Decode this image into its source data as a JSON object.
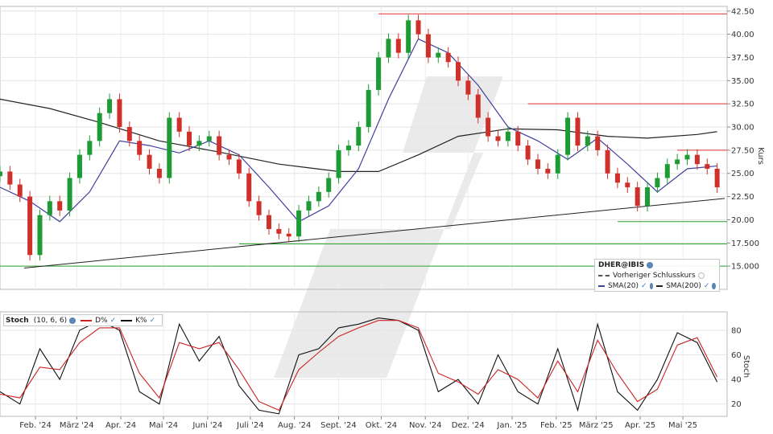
{
  "chart_data": [
    {
      "type": "candlestick",
      "title": "DHER@IBIS",
      "ylabel": "Kurs",
      "ylim": [
        12.5,
        43.0
      ],
      "y_ticks": [
        "15.000",
        "17.500",
        "20.00",
        "22.50",
        "25.00",
        "27.50",
        "30.00",
        "32.50",
        "35.00",
        "37.50",
        "40.00",
        "42.50"
      ],
      "x_ticks": [
        "Feb. '24",
        "März '24",
        "Apr. '24",
        "Mai '24",
        "Juni '24",
        "Juli '24",
        "Aug. '24",
        "Sept. '24",
        "Okt. '24",
        "Nov. '24",
        "Dez. '24",
        "Jan. '25",
        "Feb. '25",
        "März '25",
        "Apr. '25",
        "Mai '25"
      ],
      "grid": true,
      "legend_position": "bottom-right",
      "colors": {
        "up": "#1e9b35",
        "down": "#d0302a",
        "sma20": "#3f3f9e",
        "sma200": "#222222",
        "resistance": "#e03030",
        "support": "#2ca02c",
        "trend": "#222222"
      },
      "legend": {
        "title": "DHER@IBIS",
        "previous_close": "Vorheriger Schlusskurs",
        "sma20": "SMA(20)",
        "sma200": "SMA(200)"
      },
      "close_series": {
        "name": "DHER@IBIS",
        "points": [
          [
            "2024-01-15",
            25.2
          ],
          [
            "2024-01-22",
            23.8
          ],
          [
            "2024-01-29",
            22.5
          ],
          [
            "2024-02-05",
            16.2
          ],
          [
            "2024-02-12",
            20.5
          ],
          [
            "2024-02-19",
            22.0
          ],
          [
            "2024-02-26",
            21.0
          ],
          [
            "2024-03-04",
            24.5
          ],
          [
            "2024-03-11",
            27.0
          ],
          [
            "2024-03-18",
            28.5
          ],
          [
            "2024-03-25",
            31.5
          ],
          [
            "2024-04-01",
            33.0
          ],
          [
            "2024-04-08",
            30.0
          ],
          [
            "2024-04-15",
            28.5
          ],
          [
            "2024-04-22",
            27.0
          ],
          [
            "2024-04-29",
            25.5
          ],
          [
            "2024-05-06",
            24.5
          ],
          [
            "2024-05-13",
            31.0
          ],
          [
            "2024-05-20",
            29.5
          ],
          [
            "2024-05-27",
            28.0
          ],
          [
            "2024-06-03",
            28.5
          ],
          [
            "2024-06-10",
            29.0
          ],
          [
            "2024-06-17",
            27.0
          ],
          [
            "2024-06-24",
            26.5
          ],
          [
            "2024-07-01",
            25.0
          ],
          [
            "2024-07-08",
            22.0
          ],
          [
            "2024-07-15",
            20.5
          ],
          [
            "2024-07-22",
            19.0
          ],
          [
            "2024-07-29",
            18.5
          ],
          [
            "2024-08-05",
            18.2
          ],
          [
            "2024-08-12",
            21.0
          ],
          [
            "2024-08-19",
            22.0
          ],
          [
            "2024-08-26",
            23.0
          ],
          [
            "2024-09-02",
            24.5
          ],
          [
            "2024-09-09",
            27.5
          ],
          [
            "2024-09-16",
            28.0
          ],
          [
            "2024-09-23",
            30.0
          ],
          [
            "2024-09-30",
            34.0
          ],
          [
            "2024-10-07",
            37.5
          ],
          [
            "2024-10-14",
            39.5
          ],
          [
            "2024-10-21",
            38.0
          ],
          [
            "2024-10-28",
            41.5
          ],
          [
            "2024-11-04",
            40.0
          ],
          [
            "2024-11-11",
            37.5
          ],
          [
            "2024-11-18",
            38.0
          ],
          [
            "2024-11-25",
            37.0
          ],
          [
            "2024-12-02",
            35.0
          ],
          [
            "2024-12-09",
            33.5
          ],
          [
            "2024-12-16",
            31.0
          ],
          [
            "2024-12-23",
            29.0
          ],
          [
            "2024-12-30",
            28.5
          ],
          [
            "2025-01-06",
            29.5
          ],
          [
            "2025-01-13",
            28.0
          ],
          [
            "2025-01-20",
            26.5
          ],
          [
            "2025-01-27",
            25.5
          ],
          [
            "2025-02-03",
            25.0
          ],
          [
            "2025-02-10",
            27.0
          ],
          [
            "2025-02-17",
            31.0
          ],
          [
            "2025-02-24",
            28.0
          ],
          [
            "2025-03-03",
            29.0
          ],
          [
            "2025-03-10",
            27.5
          ],
          [
            "2025-03-17",
            25.0
          ],
          [
            "2025-03-24",
            24.0
          ],
          [
            "2025-03-31",
            23.5
          ],
          [
            "2025-04-07",
            21.5
          ],
          [
            "2025-04-14",
            23.5
          ],
          [
            "2025-04-21",
            24.5
          ],
          [
            "2025-04-28",
            26.0
          ],
          [
            "2025-05-05",
            26.5
          ],
          [
            "2025-05-12",
            27.0
          ],
          [
            "2025-05-19",
            26.0
          ],
          [
            "2025-05-26",
            25.5
          ],
          [
            "2025-06-02",
            23.5
          ]
        ]
      },
      "sma20_series": {
        "name": "SMA(20)",
        "points": [
          [
            "2024-01-15",
            23.5
          ],
          [
            "2024-02-05",
            22.0
          ],
          [
            "2024-02-26",
            19.8
          ],
          [
            "2024-03-18",
            23.0
          ],
          [
            "2024-04-08",
            28.5
          ],
          [
            "2024-04-29",
            28.0
          ],
          [
            "2024-05-20",
            27.2
          ],
          [
            "2024-06-10",
            28.5
          ],
          [
            "2024-07-01",
            27.0
          ],
          [
            "2024-07-22",
            23.5
          ],
          [
            "2024-08-12",
            19.8
          ],
          [
            "2024-09-02",
            21.5
          ],
          [
            "2024-09-23",
            25.5
          ],
          [
            "2024-10-14",
            33.0
          ],
          [
            "2024-11-04",
            39.5
          ],
          [
            "2024-11-25",
            38.0
          ],
          [
            "2024-12-16",
            34.5
          ],
          [
            "2025-01-06",
            30.0
          ],
          [
            "2025-01-27",
            28.5
          ],
          [
            "2025-02-17",
            26.5
          ],
          [
            "2025-03-10",
            28.8
          ],
          [
            "2025-03-31",
            26.0
          ],
          [
            "2025-04-21",
            23.0
          ],
          [
            "2025-05-12",
            25.5
          ],
          [
            "2025-06-02",
            25.8
          ]
        ]
      },
      "sma200_series": {
        "name": "SMA(200)",
        "points": [
          [
            "2024-01-15",
            33.0
          ],
          [
            "2024-02-19",
            32.0
          ],
          [
            "2024-03-25",
            30.5
          ],
          [
            "2024-05-06",
            28.5
          ],
          [
            "2024-06-17",
            27.3
          ],
          [
            "2024-07-29",
            26.0
          ],
          [
            "2024-09-09",
            25.2
          ],
          [
            "2024-10-07",
            25.2
          ],
          [
            "2024-11-04",
            27.0
          ],
          [
            "2024-12-02",
            29.0
          ],
          [
            "2025-01-06",
            29.8
          ],
          [
            "2025-02-10",
            29.7
          ],
          [
            "2025-03-17",
            29.0
          ],
          [
            "2025-04-14",
            28.8
          ],
          [
            "2025-05-19",
            29.2
          ],
          [
            "2025-06-02",
            29.5
          ]
        ]
      },
      "horizontal_lines": [
        {
          "kind": "resistance",
          "value": 42.2,
          "from": "2024-10-07",
          "to": "2025-06-09"
        },
        {
          "kind": "resistance",
          "value": 32.5,
          "from": "2025-01-20",
          "to": "2025-06-09"
        },
        {
          "kind": "resistance",
          "value": 27.5,
          "from": "2025-05-05",
          "to": "2025-06-09"
        },
        {
          "kind": "support",
          "value": 19.8,
          "from": "2025-03-24",
          "to": "2025-06-09"
        },
        {
          "kind": "support",
          "value": 17.4,
          "from": "2024-07-01",
          "to": "2025-06-09"
        },
        {
          "kind": "support",
          "value": 15.0,
          "from": "2024-01-15",
          "to": "2025-06-09"
        }
      ],
      "trend_line": {
        "from": [
          "2024-02-01",
          14.8
        ],
        "to": [
          "2025-06-09",
          22.3
        ]
      }
    },
    {
      "type": "line",
      "title": "Stoch",
      "params": "(10, 6, 6)",
      "ylabel": "Stoch",
      "ylim": [
        10,
        95
      ],
      "y_ticks": [
        "20",
        "40",
        "60",
        "80"
      ],
      "grid": true,
      "legend": {
        "d": "D%",
        "k": "K%"
      },
      "series": [
        {
          "name": "K%",
          "color": "#111111",
          "points": [
            [
              "2024-01-15",
              30
            ],
            [
              "2024-01-29",
              20
            ],
            [
              "2024-02-12",
              65
            ],
            [
              "2024-02-26",
              40
            ],
            [
              "2024-03-11",
              80
            ],
            [
              "2024-03-25",
              88
            ],
            [
              "2024-04-08",
              80
            ],
            [
              "2024-04-22",
              30
            ],
            [
              "2024-05-06",
              20
            ],
            [
              "2024-05-20",
              85
            ],
            [
              "2024-06-03",
              55
            ],
            [
              "2024-06-17",
              75
            ],
            [
              "2024-07-01",
              35
            ],
            [
              "2024-07-15",
              15
            ],
            [
              "2024-07-29",
              12
            ],
            [
              "2024-08-12",
              60
            ],
            [
              "2024-08-26",
              65
            ],
            [
              "2024-09-09",
              82
            ],
            [
              "2024-09-23",
              85
            ],
            [
              "2024-10-07",
              90
            ],
            [
              "2024-10-21",
              88
            ],
            [
              "2024-11-04",
              80
            ],
            [
              "2024-11-18",
              30
            ],
            [
              "2024-12-02",
              40
            ],
            [
              "2024-12-16",
              20
            ],
            [
              "2024-12-30",
              60
            ],
            [
              "2025-01-13",
              30
            ],
            [
              "2025-01-27",
              20
            ],
            [
              "2025-02-10",
              65
            ],
            [
              "2025-02-24",
              15
            ],
            [
              "2025-03-10",
              85
            ],
            [
              "2025-03-24",
              30
            ],
            [
              "2025-04-07",
              15
            ],
            [
              "2025-04-21",
              40
            ],
            [
              "2025-05-05",
              78
            ],
            [
              "2025-05-19",
              70
            ],
            [
              "2025-06-02",
              38
            ]
          ]
        },
        {
          "name": "D%",
          "color": "#cc2222",
          "points": [
            [
              "2024-01-15",
              28
            ],
            [
              "2024-01-29",
              25
            ],
            [
              "2024-02-12",
              50
            ],
            [
              "2024-02-26",
              48
            ],
            [
              "2024-03-11",
              70
            ],
            [
              "2024-03-25",
              82
            ],
            [
              "2024-04-08",
              82
            ],
            [
              "2024-04-22",
              45
            ],
            [
              "2024-05-06",
              25
            ],
            [
              "2024-05-20",
              70
            ],
            [
              "2024-06-03",
              65
            ],
            [
              "2024-06-17",
              70
            ],
            [
              "2024-07-01",
              48
            ],
            [
              "2024-07-15",
              22
            ],
            [
              "2024-07-29",
              15
            ],
            [
              "2024-08-12",
              48
            ],
            [
              "2024-08-26",
              62
            ],
            [
              "2024-09-09",
              75
            ],
            [
              "2024-09-23",
              82
            ],
            [
              "2024-10-07",
              88
            ],
            [
              "2024-10-21",
              88
            ],
            [
              "2024-11-04",
              82
            ],
            [
              "2024-11-18",
              45
            ],
            [
              "2024-12-02",
              38
            ],
            [
              "2024-12-16",
              28
            ],
            [
              "2024-12-30",
              48
            ],
            [
              "2025-01-13",
              40
            ],
            [
              "2025-01-27",
              25
            ],
            [
              "2025-02-10",
              55
            ],
            [
              "2025-02-24",
              30
            ],
            [
              "2025-03-10",
              72
            ],
            [
              "2025-03-24",
              45
            ],
            [
              "2025-04-07",
              22
            ],
            [
              "2025-04-21",
              32
            ],
            [
              "2025-05-05",
              68
            ],
            [
              "2025-05-19",
              74
            ],
            [
              "2025-06-02",
              42
            ]
          ]
        }
      ]
    }
  ]
}
